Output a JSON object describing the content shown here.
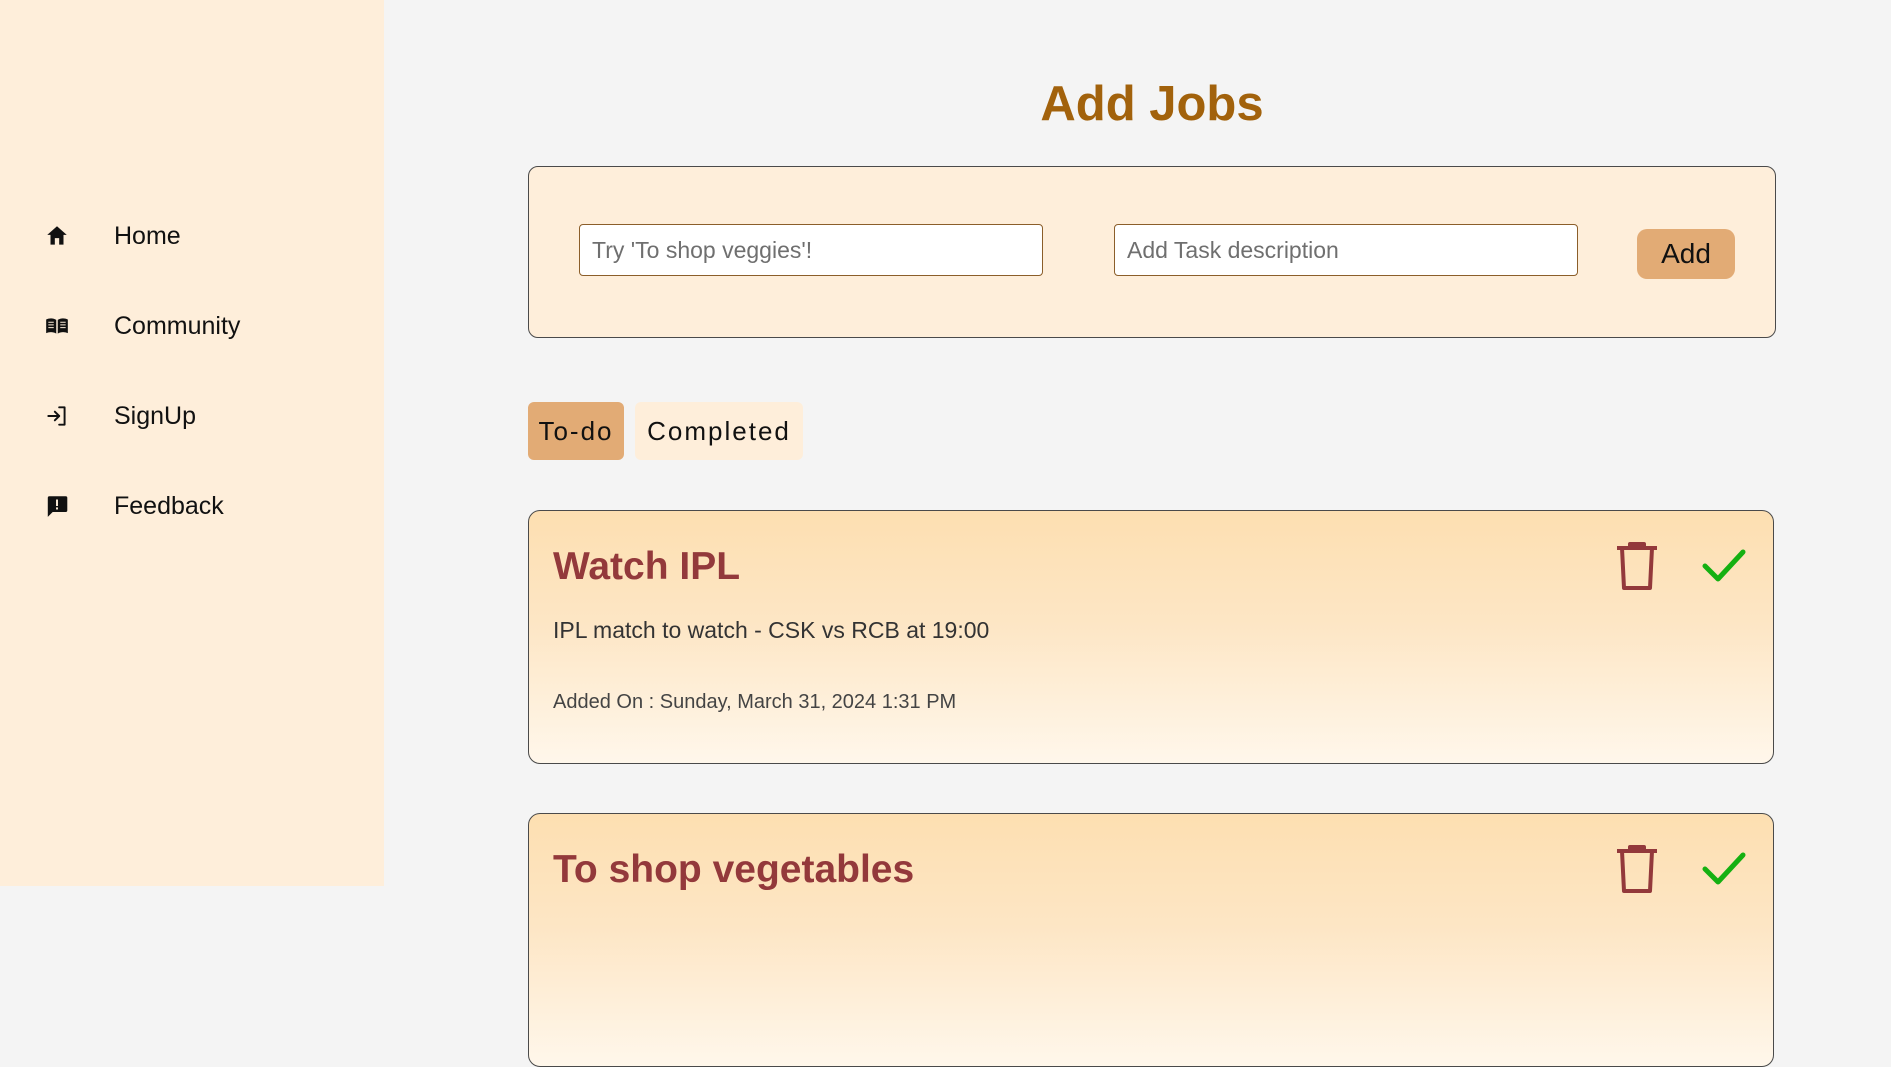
{
  "sidebar": {
    "items": [
      {
        "label": "Home",
        "icon": "home-icon"
      },
      {
        "label": "Community",
        "icon": "book-icon"
      },
      {
        "label": "SignUp",
        "icon": "sign-in-icon"
      },
      {
        "label": "Feedback",
        "icon": "feedback-icon"
      }
    ]
  },
  "main": {
    "title": "Add Jobs",
    "add_form": {
      "title_placeholder": "Try 'To shop veggies'!",
      "title_value": "",
      "description_placeholder": "Add Task description",
      "description_value": "",
      "add_label": "Add"
    },
    "tabs": [
      {
        "label": "To-do",
        "active": true
      },
      {
        "label": "Completed",
        "active": false
      }
    ],
    "tasks": [
      {
        "title": "Watch IPL",
        "description": "IPL match to watch - CSK vs RCB at 19:00",
        "added_on": "Added On : Sunday, March 31, 2024 1:31 PM"
      },
      {
        "title": "To shop vegetables",
        "description": "",
        "added_on": ""
      }
    ]
  },
  "colors": {
    "sidebar_bg": "#feeeda",
    "page_bg": "#f4f4f4",
    "title": "#a2620c",
    "accent_button": "#e2ab75",
    "task_title": "#93393b",
    "trash": "#93393b",
    "check": "#15b012"
  }
}
